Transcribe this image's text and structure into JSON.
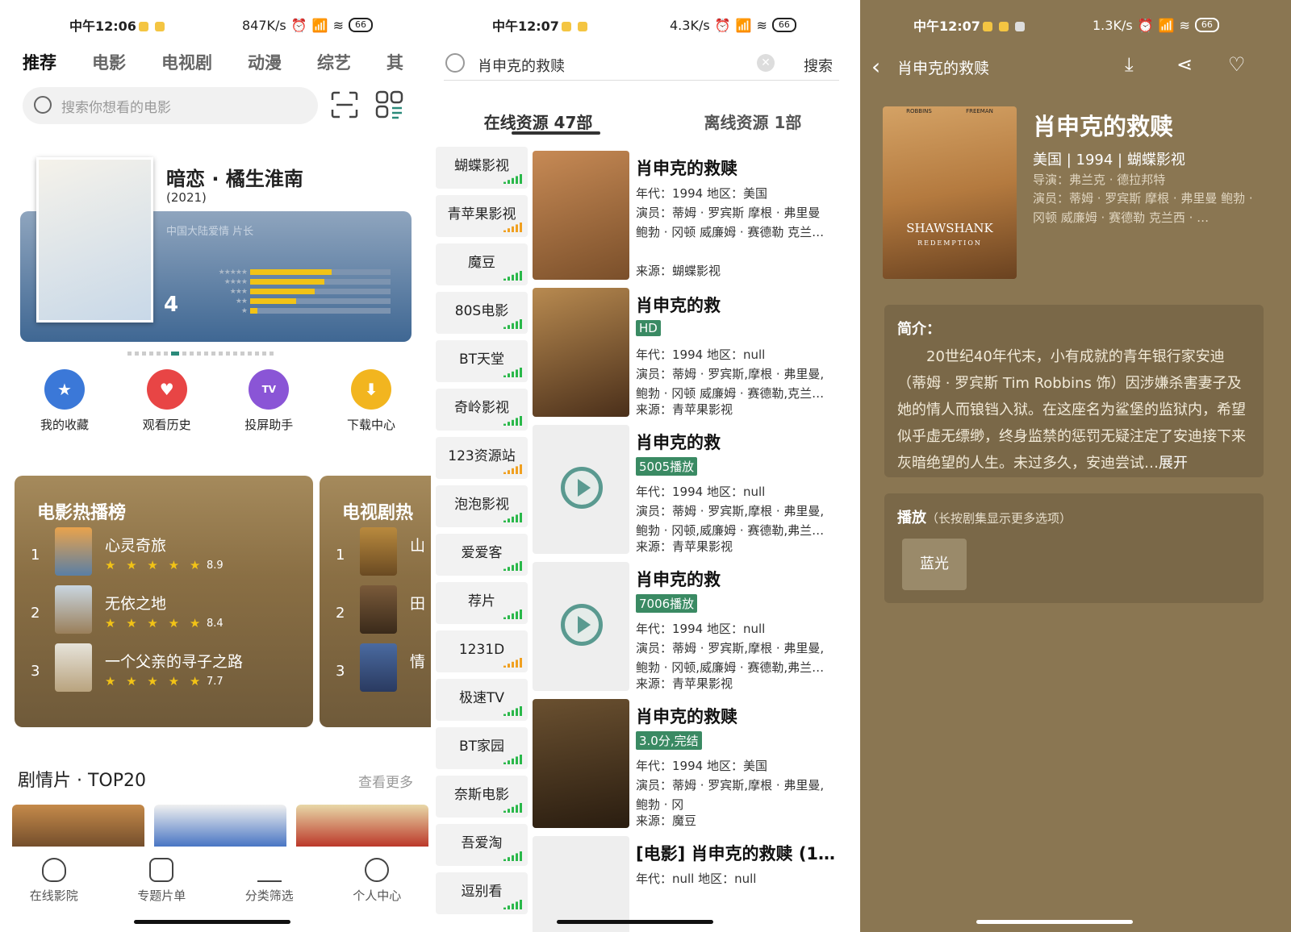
{
  "p1": {
    "status": {
      "time": "中午12:06",
      "net": "847K/s",
      "battery": "66"
    },
    "tabs": [
      "推荐",
      "电影",
      "电视剧",
      "动漫",
      "综艺",
      "其"
    ],
    "search_placeholder": "搜索你想看的电影",
    "banner": {
      "title": "暗恋 · 橘生淮南",
      "year": "(2021)",
      "genre": "中国大陆爱情 片长",
      "score": "4",
      "rating_bars": [
        0.58,
        0.53,
        0.46,
        0.33,
        0.05
      ]
    },
    "quick": [
      "我的收藏",
      "观看历史",
      "投屏助手",
      "下载中心"
    ],
    "movie_rank": {
      "title": "电影热播榜",
      "items": [
        {
          "no": "1",
          "name": "心灵奇旅",
          "score": "8.9",
          "stars": "★ ★ ★ ★ ★"
        },
        {
          "no": "2",
          "name": "无依之地",
          "score": "8.4",
          "stars": "★ ★ ★ ★ ★"
        },
        {
          "no": "3",
          "name": "一个父亲的寻子之路",
          "score": "7.7",
          "stars": "★ ★ ★ ★ ★"
        }
      ]
    },
    "tv_rank": {
      "title": "电视剧热",
      "items": [
        {
          "no": "1",
          "name": "山"
        },
        {
          "no": "2",
          "name": "田"
        },
        {
          "no": "3",
          "name": "情"
        }
      ]
    },
    "section": {
      "title": "剧情片 · TOP20",
      "more": "查看更多"
    },
    "tabbar": [
      "在线影院",
      "专题片单",
      "分类筛选",
      "个人中心"
    ]
  },
  "p2": {
    "status": {
      "time": "中午12:07",
      "net": "4.3K/s",
      "battery": "66"
    },
    "query": "肖申克的救赎",
    "search_btn": "搜索",
    "tab_online": "在线资源 47部",
    "tab_offline": "离线资源 1部",
    "sources": [
      "蝴蝶影视",
      "青苹果影视",
      "魔豆",
      "80S电影",
      "BT天堂",
      "奇岭影视",
      "123资源站",
      "泡泡影视",
      "爱爱客",
      "荐片",
      "1231D",
      "极速TV",
      "BT家园",
      "奈斯电影",
      "吾爱淘",
      "逗别看"
    ],
    "results": [
      {
        "title": "肖申克的救赎",
        "badge": "",
        "l1": "年代：1994 地区：美国",
        "l2": "演员：蒂姆 · 罗宾斯 摩根 · 弗里曼",
        "l3": "鲍勃 · 冈顿 威廉姆 · 赛德勒 克兰…",
        "l4": "来源：蝴蝶影视"
      },
      {
        "title": "肖申克的救",
        "badge": "HD",
        "l1": "年代：1994 地区：null",
        "l2": "演员：蒂姆 · 罗宾斯,摩根 · 弗里曼,",
        "l3": "鲍勃 · 冈顿 威廉姆 · 赛德勒,克兰…",
        "l4": "来源：青苹果影视"
      },
      {
        "title": "肖申克的救",
        "badge": "5005播放",
        "l1": "年代：1994 地区：null",
        "l2": "演员：蒂姆 · 罗宾斯,摩根 · 弗里曼,",
        "l3": "鲍勃 · 冈顿,威廉姆 · 赛德勒,弗兰…",
        "l4": "来源：青苹果影视"
      },
      {
        "title": "肖申克的救",
        "badge": "7006播放",
        "l1": "年代：1994 地区：null",
        "l2": "演员：蒂姆 · 罗宾斯,摩根 · 弗里曼,",
        "l3": "鲍勃 · 冈顿,威廉姆 · 赛德勒,弗兰…",
        "l4": "来源：青苹果影视"
      },
      {
        "title": "肖申克的救赎",
        "badge": "3.0分,完结",
        "l1": "年代：1994 地区：美国",
        "l2": "演员：蒂姆 · 罗宾斯,摩根 · 弗里曼,",
        "l3": "鲍勃 · 冈",
        "l4": "来源：魔豆"
      },
      {
        "title": "[电影] 肖申克的救赎 (1…",
        "badge": "",
        "l1": "年代：null 地区：null",
        "l2": "",
        "l3": "",
        "l4": ""
      }
    ]
  },
  "p3": {
    "status": {
      "time": "中午12:07",
      "net": "1.3K/s",
      "battery": "66"
    },
    "nav_title": "肖申克的救赎",
    "poster": {
      "names": "ROBBINS FREEMAN",
      "title": "SHAWSHANK",
      "sub": "REDEMPTION"
    },
    "title": "肖申克的救赎",
    "meta": "美国 | 1994 | 蝴蝶影视",
    "director": "导演：弗兰克 · 德拉邦特",
    "cast": "演员：蒂姆 · 罗宾斯 摩根 · 弗里曼 鲍勃 · 冈顿 威廉姆 · 赛德勒 克兰西 · …",
    "synopsis_label": "简介：",
    "synopsis": "20世纪40年代末，小有成就的青年银行家安迪（蒂姆 · 罗宾斯 Tim Robbins 饰）因涉嫌杀害妻子及她的情人而锒铛入狱。在这座名为鲨堡的监狱内，希望似乎虚无缥缈，终身监禁的惩罚无疑注定了安迪接下来灰暗绝望的人生。未过多久，安迪尝试…",
    "expand": "展开",
    "play_label": "播放",
    "play_hint": "（长按剧集显示更多选项）",
    "play_btn": "蓝光"
  },
  "colors": {
    "accent": "#2a8a7a",
    "badge": "#3a8a63",
    "detail_bg": "#8a7652",
    "star": "#f2c316"
  }
}
